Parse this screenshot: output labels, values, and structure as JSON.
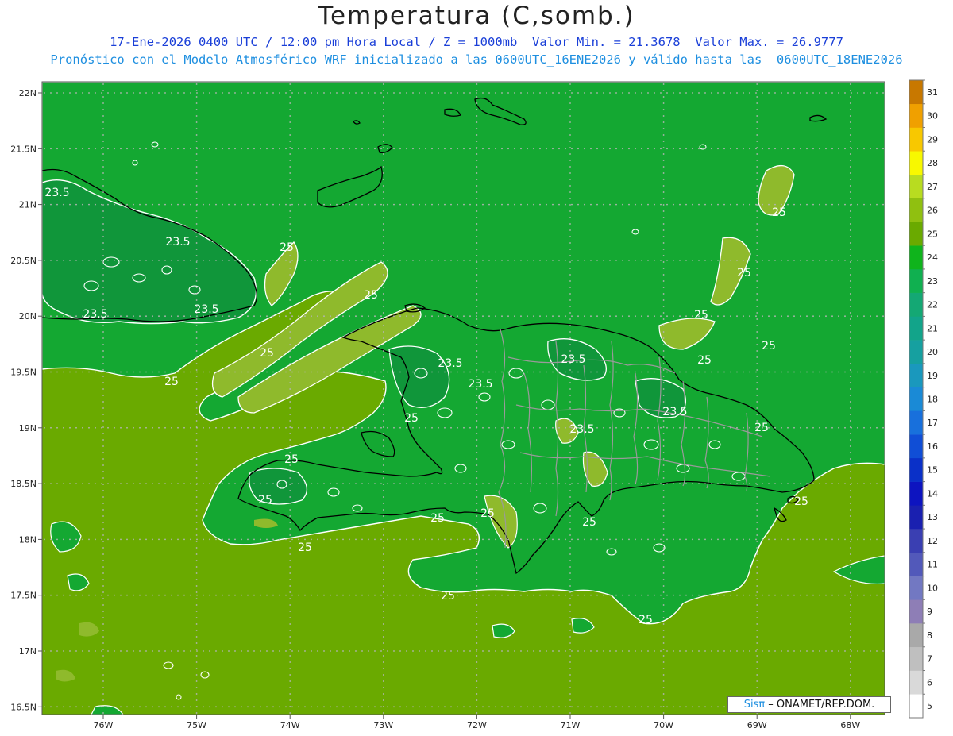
{
  "title": "Temperatura (C,somb.)",
  "subtitle_1": "17-Ene-2026 0400 UTC / 12:00 pm Hora Local / Z = 1000mb  Valor Min. = 21.3678  Valor Max. = 26.9777",
  "subtitle_2": "Pronóstico con el Modelo Atmosférico WRF inicializado a las 0600UTC_16ENE2026 y válido hasta las  0600UTC_18ENE2026",
  "credit": {
    "brand": "Sisπ",
    "text": " – ONAMET/REP.DOM."
  },
  "axes": {
    "lat_labels": [
      "22N",
      "21.5N",
      "21N",
      "20.5N",
      "20N",
      "19.5N",
      "19N",
      "18.5N",
      "18N",
      "17.5N",
      "17N",
      "16.5N"
    ],
    "lon_labels": [
      "76W",
      "75W",
      "74W",
      "73W",
      "72W",
      "71W",
      "70W",
      "69W",
      "68W"
    ]
  },
  "colorbar": {
    "labels": [
      "5",
      "6",
      "7",
      "8",
      "9",
      "10",
      "11",
      "12",
      "13",
      "14",
      "15",
      "16",
      "17",
      "18",
      "19",
      "20",
      "21",
      "22",
      "23",
      "24",
      "25",
      "26",
      "27",
      "28",
      "29",
      "30",
      "31"
    ],
    "colors": [
      "#ffffff",
      "#d9d9d9",
      "#bfbfbf",
      "#a9a9a9",
      "#8e7eb6",
      "#7278c2",
      "#5259ba",
      "#3a3fb2",
      "#1a20b0",
      "#0d14c0",
      "#0a30c8",
      "#104ed6",
      "#1870dc",
      "#1a8ad6",
      "#1a98bd",
      "#16a0a0",
      "#12a48a",
      "#14a874",
      "#10b050",
      "#0fb41c",
      "#6aaa00",
      "#90c010",
      "#b8dc20",
      "#f8f800",
      "#f8c800",
      "#f0a000",
      "#c87800"
    ]
  },
  "contour_labels": [
    "23.5",
    "23.5",
    "23.5",
    "23.5",
    "23.5",
    "23.5",
    "23.5",
    "23.5",
    "23.5",
    "25",
    "25",
    "25",
    "25",
    "25",
    "25",
    "25",
    "25",
    "25",
    "25",
    "25",
    "25",
    "25",
    "25",
    "25",
    "25",
    "25",
    "25",
    "25",
    "25"
  ],
  "colors": {
    "map_base": "#6aaa00",
    "warm_patch": "#8fba2c",
    "cool_zone": "#14a832",
    "cooler_zone": "#10963a",
    "coast_line": "#000000",
    "border_line": "#9a9a9a",
    "contour_line": "#ffffff",
    "grid_dot": "#b5b5b5",
    "title_blue": "#1a3fd8",
    "subtitle_cyan": "#1e8fe0"
  }
}
